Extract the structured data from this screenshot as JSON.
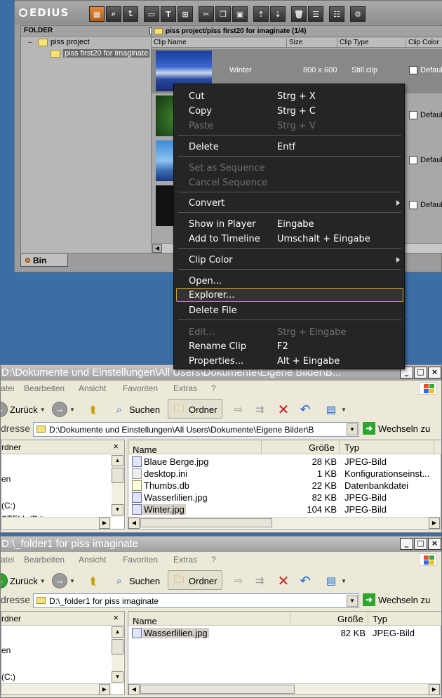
{
  "edius": {
    "app_name": "EDIUS",
    "folder_header": "FOLDER",
    "folder_close": "×",
    "tree": [
      {
        "label": "piss project",
        "toggle": "–"
      },
      {
        "label": "piss first20 for imaginate"
      }
    ],
    "bin_tab": "Bin",
    "clip_path": "piss project/piss first20 for imaginate (1/4)",
    "columns": [
      "Clip Name",
      "Size",
      "Clip Type",
      "Clip Color"
    ],
    "clips": [
      {
        "name": "Winter",
        "size": "800 x 600",
        "type": "Still clip",
        "color": "Default"
      },
      {
        "name": "",
        "size": "",
        "type": "",
        "color": "Default"
      },
      {
        "name": "",
        "size": "",
        "type": "",
        "color": "Default"
      },
      {
        "name": "",
        "size": "",
        "type": "",
        "color": "Default"
      }
    ],
    "toolbar_icons": [
      "bin-icon",
      "find-icon",
      "up-icon",
      "open-icon",
      "title-icon",
      "import-icon",
      "cut-icon",
      "copy-icon",
      "paste-icon",
      "player-icon",
      "timeline-icon",
      "delete-icon",
      "properties-icon",
      "view-icon",
      "tools-icon"
    ]
  },
  "context_menu": {
    "items": [
      {
        "label": "Cut",
        "shortcut": "Strg + X",
        "disabled": false
      },
      {
        "label": "Copy",
        "shortcut": "Strg + C",
        "disabled": false
      },
      {
        "label": "Paste",
        "shortcut": "Strg + V",
        "disabled": true
      },
      {
        "label": "Delete",
        "shortcut": "Entf",
        "disabled": false
      },
      {
        "label": "Set as Sequence",
        "shortcut": "",
        "disabled": true
      },
      {
        "label": "Cancel Sequence",
        "shortcut": "",
        "disabled": true
      },
      {
        "label": "Convert",
        "shortcut": "",
        "disabled": false,
        "submenu": true
      },
      {
        "label": "Show in Player",
        "shortcut": "Eingabe",
        "disabled": false
      },
      {
        "label": "Add to Timeline",
        "shortcut": "Umschalt + Eingabe",
        "disabled": false
      },
      {
        "label": "Clip Color",
        "shortcut": "",
        "disabled": false,
        "submenu": true
      },
      {
        "label": "Open...",
        "shortcut": "",
        "disabled": false
      },
      {
        "label": "Explorer...",
        "shortcut": "",
        "disabled": false,
        "highlighted": true
      },
      {
        "label": "Delete File",
        "shortcut": "",
        "disabled": false
      },
      {
        "label": "Edit...",
        "shortcut": "Strg + Eingabe",
        "disabled": true
      },
      {
        "label": "Rename Clip",
        "shortcut": "F2",
        "disabled": false
      },
      {
        "label": "Properties...",
        "shortcut": "Alt + Eingabe",
        "disabled": false
      }
    ]
  },
  "explorer1": {
    "title": "D:\\Dokumente und Einstellungen\\All Users\\Dokumente\\Eigene Bilder\\B...",
    "menu": [
      "atei",
      "Bearbeiten",
      "Ansicht",
      "Favoriten",
      "Extras",
      "?"
    ],
    "back_label": "Zurück",
    "search_label": "Suchen",
    "folders_label": "Ordner",
    "address_label": "dresse",
    "address_value": "D:\\Dokumente und Einstellungen\\All Users\\Dokumente\\Eigene Bilder\\B",
    "go_label": "Wechseln zu",
    "folders_header": "rdner",
    "folders_close": "×",
    "folder_texts": [
      "en",
      "(C:)",
      "STELL (D:)"
    ],
    "columns": {
      "name": "Name",
      "size": "Größe",
      "type": "Typ"
    },
    "files": [
      {
        "name": "Blaue Berge.jpg",
        "size": "28 KB",
        "type": "JPEG-Bild"
      },
      {
        "name": "desktop.ini",
        "size": "1 KB",
        "type": "Konfigurationseinst..."
      },
      {
        "name": "Thumbs.db",
        "size": "22 KB",
        "type": "Datenbankdatei"
      },
      {
        "name": "Wasserlilien.jpg",
        "size": "82 KB",
        "type": "JPEG-Bild"
      },
      {
        "name": "Winter.jpg",
        "size": "104 KB",
        "type": "JPEG-Bild"
      }
    ]
  },
  "explorer2": {
    "title": "D:\\_folder1 for piss imaginate",
    "menu": [
      "atei",
      "Bearbeiten",
      "Ansicht",
      "Favoriten",
      "Extras",
      "?"
    ],
    "back_label": "Zurück",
    "search_label": "Suchen",
    "folders_label": "Ordner",
    "address_label": "dresse",
    "address_value": "D:\\_folder1 for piss imaginate",
    "go_label": "Wechseln zu",
    "folders_header": "rdner",
    "folders_close": "×",
    "folder_texts": [
      "en",
      "(C:)"
    ],
    "columns": {
      "name": "Name",
      "size": "Größe",
      "type": "Typ"
    },
    "files": [
      {
        "name": "Wasserlilien.jpg",
        "size": "82 KB",
        "type": "JPEG-Bild"
      }
    ]
  },
  "window_buttons": {
    "minimize": "_",
    "maximize": "□",
    "close": "×"
  },
  "colors": {
    "desktop": "#3a6ea5",
    "menu_bg": "#252525",
    "menu_highlight": "#d8a02c",
    "edius_accent": "#d48a2c"
  }
}
